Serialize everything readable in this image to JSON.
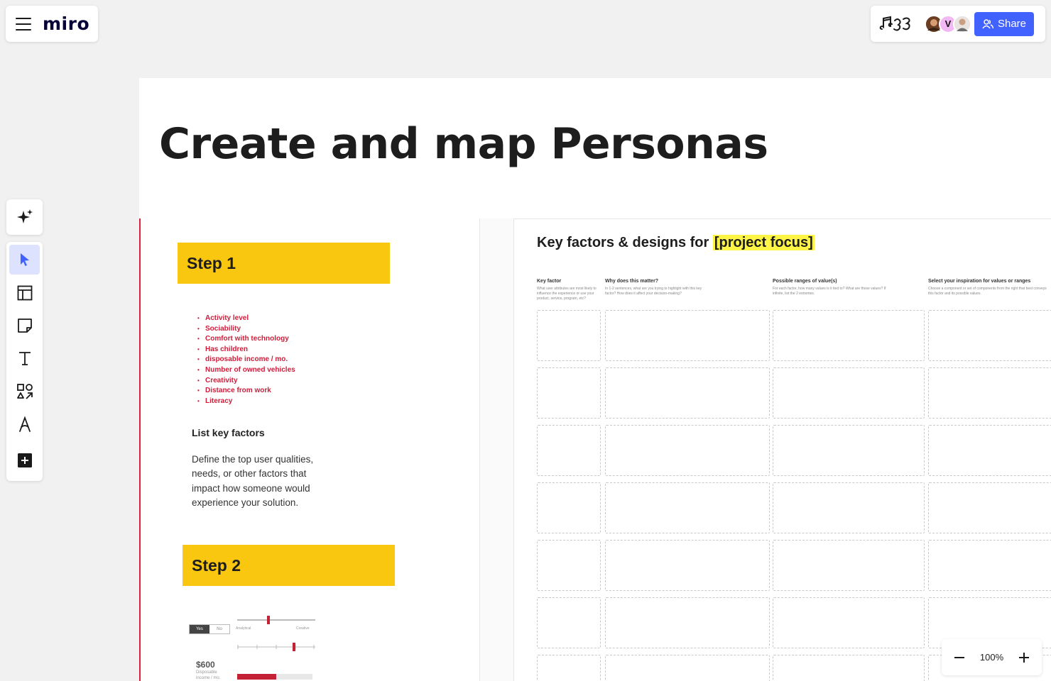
{
  "app": {
    "logo": "miro"
  },
  "topbar": {
    "share_label": "Share",
    "collaborator_initial": "V"
  },
  "board": {
    "title": "Create and map Personas",
    "step1": {
      "label": "Step 1"
    },
    "factors": [
      "Activity level",
      "Sociability",
      "Comfort with technology",
      "Has children",
      "disposable income / mo.",
      "Number of owned vehicles",
      "Creativity",
      "Distance from work",
      "Literacy"
    ],
    "list_title": "List key factors",
    "list_body": "Define the top user qualities, needs, or other factors that impact how someone would experience your solution.",
    "step2": {
      "label": "Step 2"
    },
    "mini": {
      "toggle_yes": "Yes",
      "toggle_no": "No",
      "slider_left": "Analytical",
      "slider_right": "Creative",
      "price": "$600",
      "price_sub": "Disposable income / mo."
    },
    "key_factors": {
      "title_prefix": "Key factors & designs for ",
      "title_highlight": "[project focus]",
      "columns": [
        {
          "header": "Key factor",
          "desc": "What user attributes are most likely to influence the experience or use your product, service, program, etc?"
        },
        {
          "header": "Why does this matter?",
          "desc": "In 1-2 sentences, what are you trying to highlight with this key factor? How does it affect your decision-making?"
        },
        {
          "header": "Possible ranges of value(s)",
          "desc": "For each factor, how many values is it tied to? What are those values? If infinite, list the 2 extremes."
        },
        {
          "header": "Select your inspiration for values or ranges",
          "desc": "Choose a component or set of components from the right that best conveys this factor and its possible values."
        }
      ]
    }
  },
  "zoom": {
    "level": "100%"
  }
}
